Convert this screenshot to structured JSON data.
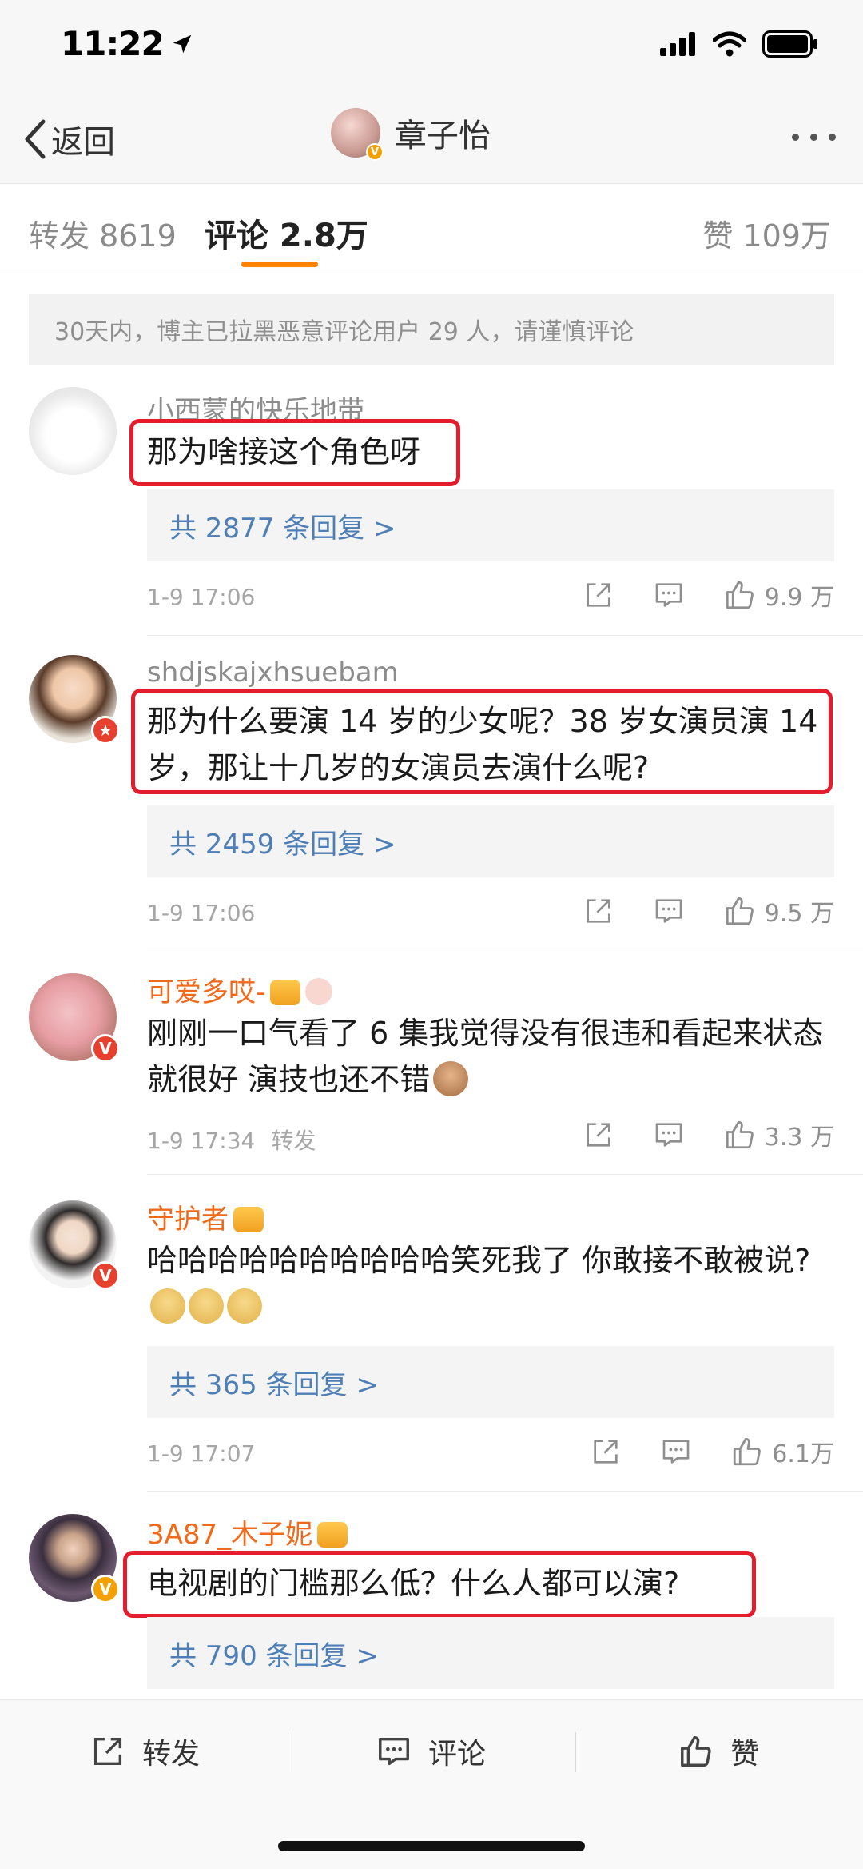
{
  "status_bar": {
    "time": "11:22"
  },
  "nav": {
    "back_label": "返回",
    "title": "章子怡"
  },
  "tabs": {
    "repost": "转发 8619",
    "comment": "评论 2.8万",
    "like": "赞 109万"
  },
  "notice": "30天内，博主已拉黑恶意评论用户 29 人，请谨慎评论",
  "comments": [
    {
      "username": "小西蒙的快乐地带",
      "text": "那为啥接这个角色呀",
      "replies": "共 2877 条回复 >",
      "time": "1-9 17:06",
      "likes": "9.9 万"
    },
    {
      "username": "shdjskajxhsuebam",
      "text": "那为什么要演 14 岁的少女呢？38 岁女演员演 14 岁，那让十几岁的女演员去演什么呢?",
      "replies": "共 2459 条回复 >",
      "time": "1-9 17:06",
      "likes": "9.5 万"
    },
    {
      "username": "可爱多哎-",
      "text": "刚刚一口气看了 6 集我觉得没有很违和看起来状态就很好 演技也还不错",
      "time": "1-9 17:34",
      "repost_label": "转发",
      "likes": "3.3 万"
    },
    {
      "username": "守护者",
      "text": "哈哈哈哈哈哈哈哈哈哈笑死我了 你敢接不敢被说?",
      "replies": "共 365 条回复 >",
      "time": "1-9 17:07",
      "likes": "6.1万"
    },
    {
      "username": "3A87_木子妮",
      "text": "电视剧的门槛那么低？什么人都可以演?",
      "replies": "共 790 条回复 >"
    }
  ],
  "bottom_bar": {
    "repost": "转发",
    "comment": "评论",
    "like": "赞"
  },
  "colors": {
    "accent": "#ff8200",
    "link": "#4d7eb5",
    "highlight": "#e51c2c",
    "vip_name": "#f06a1a"
  }
}
